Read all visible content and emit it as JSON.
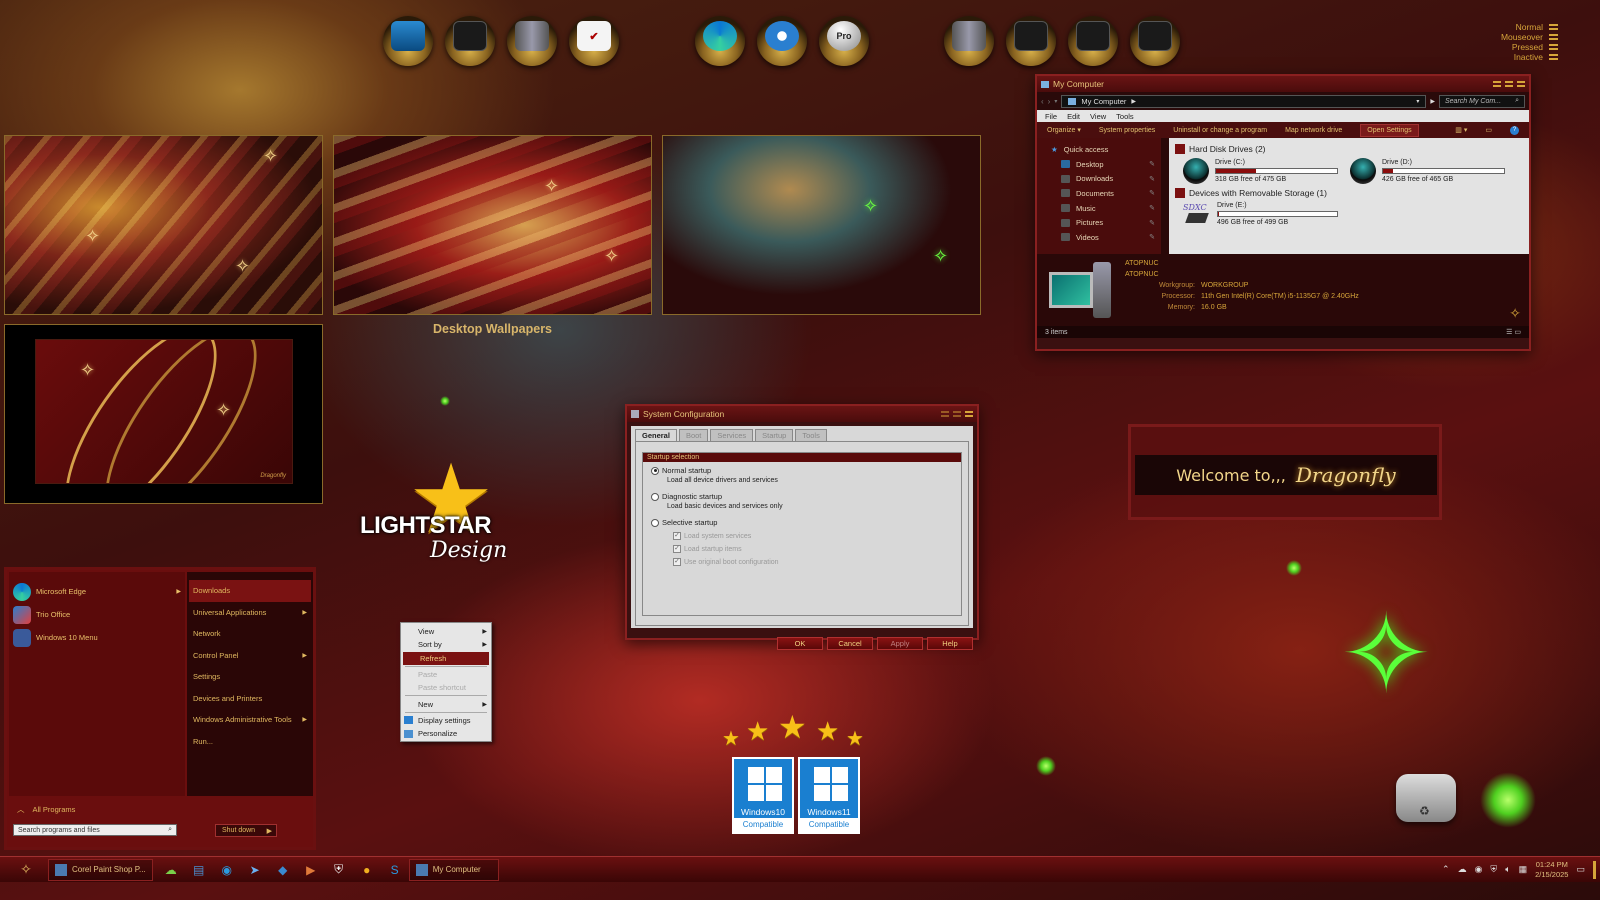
{
  "legend": {
    "states": [
      "Normal",
      "Mouseover",
      "Pressed",
      "Inactive"
    ]
  },
  "top_dock": {
    "left_group": [
      "computer-icon",
      "folder-icon",
      "tower-pc-icon",
      "checklist-icon"
    ],
    "center_group": [
      "edge-icon",
      "thunderbird-icon",
      "disc-pro-icon"
    ],
    "center_pro_label": "Pro",
    "right_group": [
      "tower-pc-icon",
      "folder-icon",
      "folder-icon",
      "folder-icon"
    ]
  },
  "wallpapers": {
    "caption": "Desktop Wallpapers",
    "signature": "Dragonfly"
  },
  "explorer": {
    "title": "My Computer",
    "address": "My Computer",
    "search_placeholder": "Search My Com...",
    "menu": [
      "File",
      "Edit",
      "View",
      "Tools"
    ],
    "commands": [
      "Organize",
      "System properties",
      "Uninstall or change a program",
      "Map network drive",
      "Open Settings"
    ],
    "nav": {
      "quick_access": "Quick access",
      "items": [
        "Desktop",
        "Downloads",
        "Documents",
        "Music",
        "Pictures",
        "Videos"
      ]
    },
    "groups": {
      "hdd": "Hard Disk Drives (2)",
      "removable": "Devices with Removable Storage (1)"
    },
    "drives": [
      {
        "name": "Drive (C:)",
        "free": "318 GB free of 475 GB",
        "used_fraction": 0.33
      },
      {
        "name": "Drive (D:)",
        "free": "426 GB free of 465 GB",
        "used_fraction": 0.08
      },
      {
        "name": "Drive (E:)",
        "free": "496 GB free of 499 GB",
        "used_fraction": 0.01
      }
    ],
    "sdxc_label": "SDXC",
    "details": {
      "name": "ATOPNUC",
      "name2": "ATOPNUC",
      "workgroup_label": "Workgroup:",
      "workgroup": "WORKGROUP",
      "processor_label": "Processor:",
      "processor": "11th Gen Intel(R) Core(TM) i5-1135G7 @ 2.40GHz",
      "memory_label": "Memory:",
      "memory": "16.0 GB"
    },
    "status": "3 items"
  },
  "sysconfig": {
    "title": "System Configuration",
    "tabs": [
      "General",
      "Boot",
      "Services",
      "Startup",
      "Tools"
    ],
    "group_caption": "Startup selection",
    "normal": "Normal startup",
    "normal_desc": "Load all device drivers and services",
    "diagnostic": "Diagnostic startup",
    "diagnostic_desc": "Load basic devices and services only",
    "selective": "Selective startup",
    "checks": [
      "Load system services",
      "Load startup items",
      "Use original boot configuration"
    ],
    "buttons": [
      "OK",
      "Cancel",
      "Apply",
      "Help"
    ]
  },
  "welcome": {
    "prefix": "Welcome to,,,",
    "name": "Dragonfly"
  },
  "lightstar": {
    "line1": "LIGHTSTAR",
    "line2": "Design"
  },
  "start_menu": {
    "pinned": [
      "Microsoft Edge",
      "Trio Office",
      "Windows 10 Menu"
    ],
    "right": [
      "Downloads",
      "Universal Applications",
      "Network",
      "Control Panel",
      "Settings",
      "Devices and Printers",
      "Windows Administrative Tools",
      "Run..."
    ],
    "all_programs": "All Programs",
    "search_placeholder": "Search programs and files",
    "shutdown": "Shut down"
  },
  "context_menu": {
    "view": "View",
    "sort_by": "Sort by",
    "refresh": "Refresh",
    "paste": "Paste",
    "paste_shortcut": "Paste shortcut",
    "new": "New",
    "display_settings": "Display settings",
    "personalize": "Personalize"
  },
  "badges": [
    {
      "name": "Windows10",
      "caption": "Compatible"
    },
    {
      "name": "Windows11",
      "caption": "Compatible"
    }
  ],
  "taskbar": {
    "tasks": [
      "Corel Paint Shop P...",
      "My Computer"
    ],
    "time": "01:24 PM",
    "date": "2/15/2025"
  },
  "colors": {
    "accent": "#7a1212",
    "gold": "#d6a53a",
    "glow_green": "#4fd020"
  }
}
